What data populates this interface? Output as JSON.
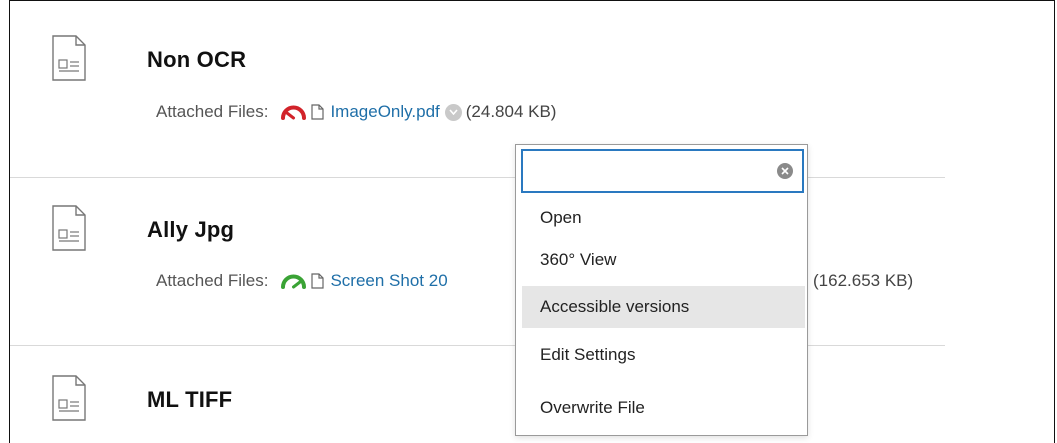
{
  "items": [
    {
      "title": "Non OCR",
      "files_label": "Attached Files:",
      "file_name": "ImageOnly.pdf",
      "file_size": "(24.804 KB)",
      "gauge_color": "#d2232a",
      "gauge_icon": "accessibility-gauge-low"
    },
    {
      "title": "Ally Jpg",
      "files_label": "Attached Files:",
      "file_name": "Screen Shot 20",
      "file_size": "(162.653 KB)",
      "gauge_color": "#3aa335",
      "gauge_icon": "accessibility-gauge-high"
    },
    {
      "title": "ML TIFF"
    }
  ],
  "menu": {
    "search_value": "",
    "items": [
      "Open",
      "360° View",
      "Accessible versions",
      "Edit Settings",
      "Overwrite File"
    ],
    "highlighted_index": 2,
    "highlight_color": "#e6e6e6",
    "search_border_color": "#2a79c0"
  },
  "colors": {
    "link": "#1f6fa8"
  }
}
